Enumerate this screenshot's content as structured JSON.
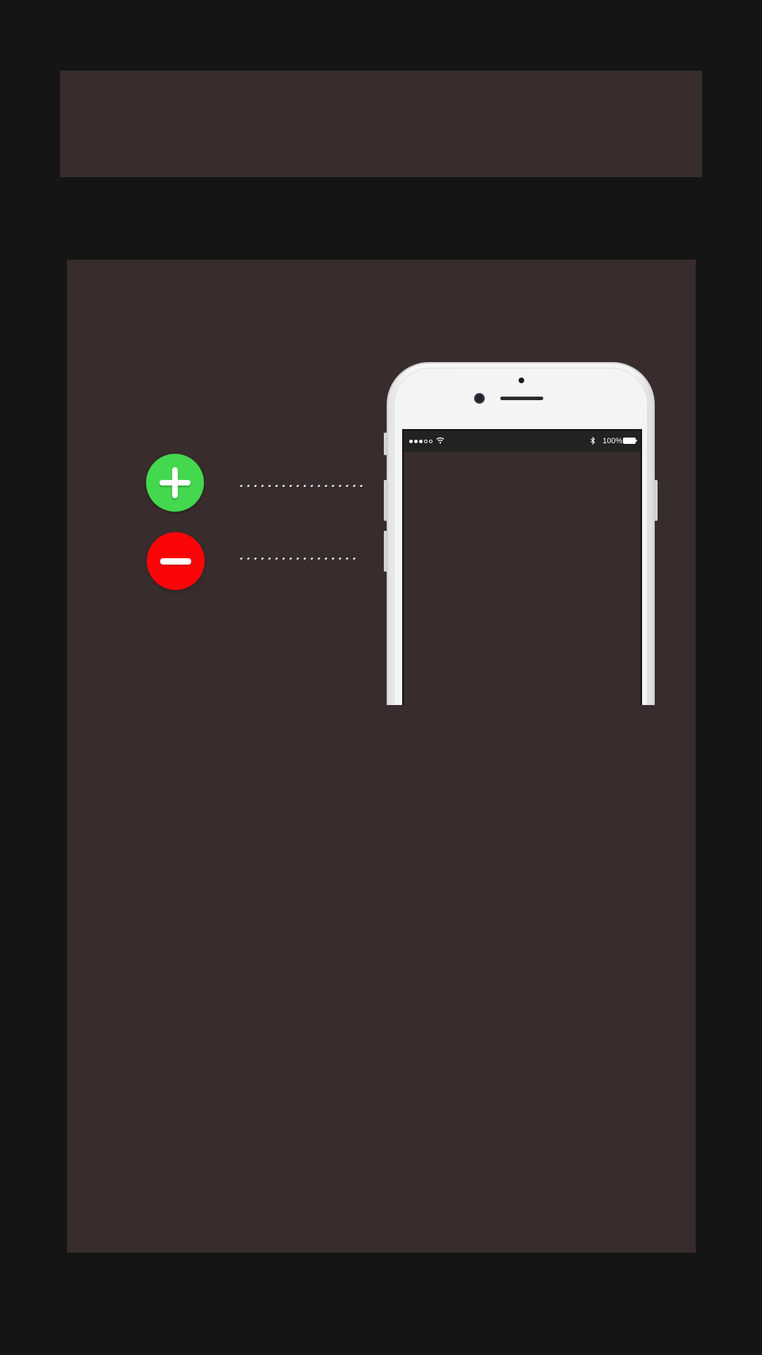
{
  "controls": {
    "add_icon": "plus-icon",
    "remove_icon": "minus-icon",
    "add_color": "#43d84d",
    "remove_color": "#fb0509"
  },
  "phone": {
    "status_bar": {
      "signal_icon": "signal-dots-icon",
      "signal_filled": 3,
      "signal_total": 5,
      "wifi_icon": "wifi-icon",
      "bluetooth_icon": "bluetooth-icon",
      "battery_text": "100%",
      "battery_icon": "battery-icon"
    }
  },
  "colors": {
    "page_background": "#151515",
    "panel_background": "#382c2c",
    "status_bar_background": "#222222",
    "phone_body": "#f5f5f5"
  }
}
